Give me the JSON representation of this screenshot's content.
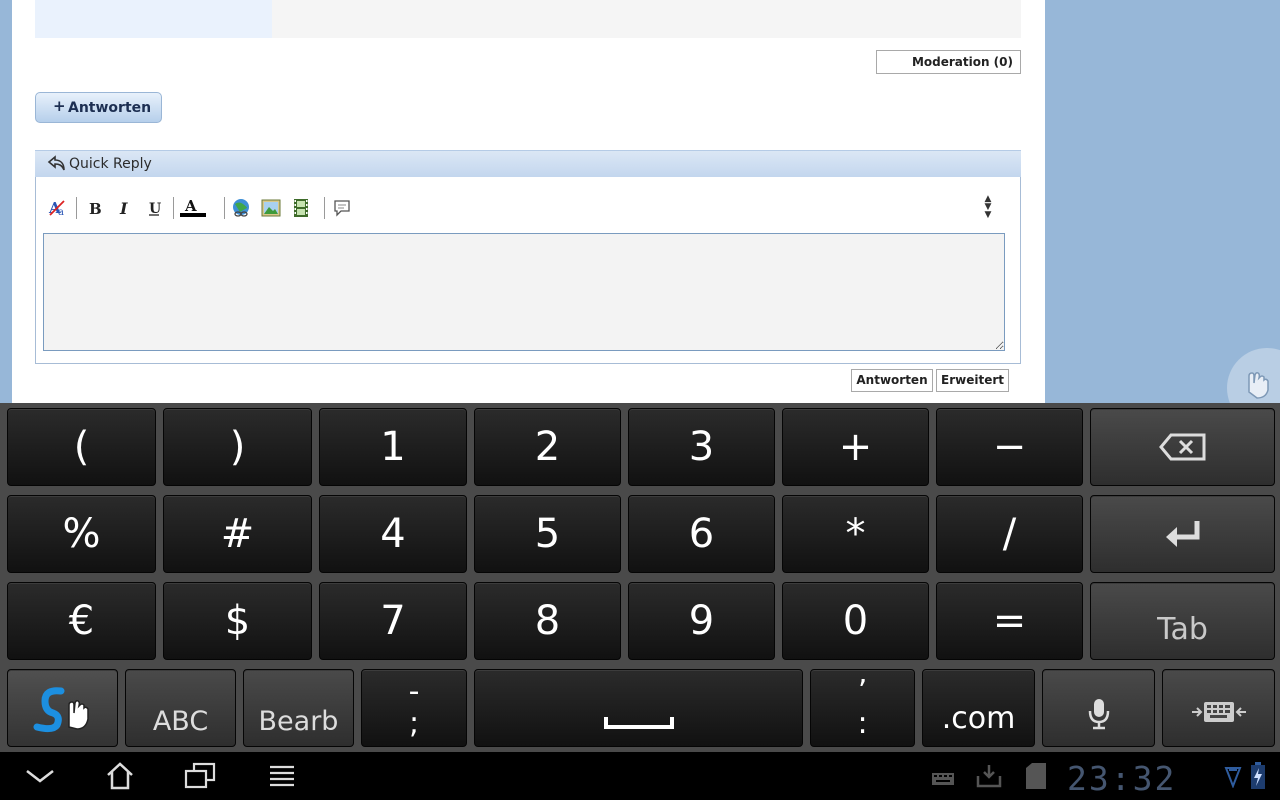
{
  "page": {
    "moderation_label": "Moderation (0)",
    "reply_plus": "+",
    "reply_label": "Antworten",
    "quick_reply_title": "Quick Reply",
    "submit_label": "Antworten",
    "advanced_label": "Erweitert",
    "message_value": "",
    "toolbar_icons": [
      "remove-format-icon",
      "bold-icon",
      "italic-icon",
      "underline-icon",
      "font-color-icon",
      "insert-link-icon",
      "insert-image-icon",
      "insert-video-icon",
      "quote-icon",
      "resize-icon"
    ]
  },
  "keyboard": {
    "row1": [
      "(",
      ")",
      "1",
      "2",
      "3",
      "+",
      "−",
      "backspace-icon"
    ],
    "row2": [
      "%",
      "#",
      "4",
      "5",
      "6",
      "*",
      "/",
      "enter-icon"
    ],
    "row3": [
      "€",
      "$",
      "7",
      "8",
      "9",
      "0",
      "=",
      "Tab"
    ],
    "row4": [
      "swype-icon",
      "ABC",
      "Bearb",
      "-\n;",
      "space-icon",
      "’\n:",
      ".com",
      "microphone-icon",
      "keyboard-settings-icon"
    ]
  },
  "system_bar": {
    "clock": "23:32",
    "nav_icons": [
      "back-icon",
      "home-icon",
      "recent-apps-icon",
      "menu-icon"
    ],
    "status_icons": [
      "keyboard-icon",
      "download-icon",
      "sd-card-icon",
      "wifi-icon",
      "battery-icon"
    ]
  },
  "colors": {
    "page_bg": "#97b7d8",
    "keyboard_bg": "#4a4a4a",
    "clock_color": "#455670"
  }
}
